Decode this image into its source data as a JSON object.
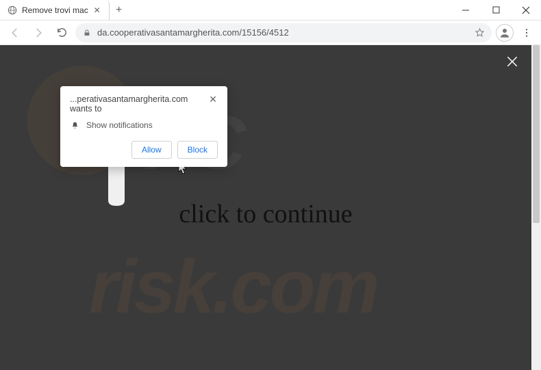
{
  "window": {
    "tab_title": "Remove trovi mac"
  },
  "toolbar": {
    "url": "da.cooperativasantamargherita.com/15156/4512"
  },
  "notification": {
    "title": "...perativasantamargherita.com wants to",
    "permission": "Show notifications",
    "allow": "Allow",
    "block": "Block"
  },
  "page": {
    "cta": "click to continue"
  },
  "watermark": {
    "line1": "PC",
    "line2": "risk.com"
  }
}
